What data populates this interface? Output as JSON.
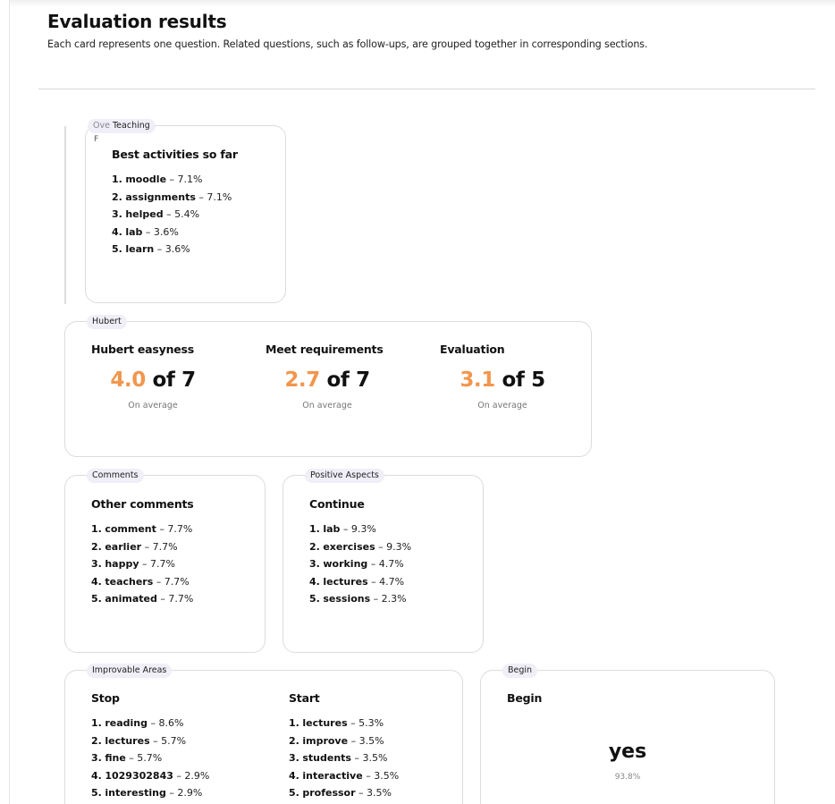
{
  "header": {
    "title": "Evaluation results",
    "subtitle": "Each card represents one question. Related questions, such as follow-ups, are grouped together in corresponding sections."
  },
  "teaching": {
    "tag": "Teaching",
    "partial_tag": "Ove",
    "partial_tag2": "F",
    "card": {
      "title": "Best activities so far",
      "items": [
        {
          "rank": "1.",
          "word": "moodle",
          "pct": "7.1%"
        },
        {
          "rank": "2.",
          "word": "assignments",
          "pct": "7.1%"
        },
        {
          "rank": "3.",
          "word": "helped",
          "pct": "5.4%"
        },
        {
          "rank": "4.",
          "word": "lab",
          "pct": "3.6%"
        },
        {
          "rank": "5.",
          "word": "learn",
          "pct": "3.6%"
        }
      ]
    }
  },
  "hubert": {
    "tag": "Hubert",
    "metrics": [
      {
        "title": "Hubert easyness",
        "value": "4.0",
        "of": " of 7",
        "caption": "On average"
      },
      {
        "title": "Meet requirements",
        "value": "2.7",
        "of": " of 7",
        "caption": "On average"
      },
      {
        "title": "Evaluation",
        "value": "3.1",
        "of": " of 5",
        "caption": "On average"
      }
    ]
  },
  "comments": {
    "tag": "Comments",
    "card": {
      "title": "Other comments",
      "items": [
        {
          "rank": "1.",
          "word": "comment",
          "pct": "7.7%"
        },
        {
          "rank": "2.",
          "word": "earlier",
          "pct": "7.7%"
        },
        {
          "rank": "3.",
          "word": "happy",
          "pct": "7.7%"
        },
        {
          "rank": "4.",
          "word": "teachers",
          "pct": "7.7%"
        },
        {
          "rank": "5.",
          "word": "animated",
          "pct": "7.7%"
        }
      ]
    }
  },
  "positive": {
    "tag": "Positive Aspects",
    "card": {
      "title": "Continue",
      "items": [
        {
          "rank": "1.",
          "word": "lab",
          "pct": "9.3%"
        },
        {
          "rank": "2.",
          "word": "exercises",
          "pct": "9.3%"
        },
        {
          "rank": "3.",
          "word": "working",
          "pct": "4.7%"
        },
        {
          "rank": "4.",
          "word": "lectures",
          "pct": "4.7%"
        },
        {
          "rank": "5.",
          "word": "sessions",
          "pct": "2.3%"
        }
      ]
    }
  },
  "improvable": {
    "tag": "Improvable Areas",
    "stop": {
      "title": "Stop",
      "items": [
        {
          "rank": "1.",
          "word": "reading",
          "pct": "8.6%"
        },
        {
          "rank": "2.",
          "word": "lectures",
          "pct": "5.7%"
        },
        {
          "rank": "3.",
          "word": "fine",
          "pct": "5.7%"
        },
        {
          "rank": "4.",
          "word": "1029302843",
          "pct": "2.9%"
        },
        {
          "rank": "5.",
          "word": "interesting",
          "pct": "2.9%"
        }
      ]
    },
    "start": {
      "title": "Start",
      "items": [
        {
          "rank": "1.",
          "word": "lectures",
          "pct": "5.3%"
        },
        {
          "rank": "2.",
          "word": "improve",
          "pct": "3.5%"
        },
        {
          "rank": "3.",
          "word": "students",
          "pct": "3.5%"
        },
        {
          "rank": "4.",
          "word": "interactive",
          "pct": "3.5%"
        },
        {
          "rank": "5.",
          "word": "professor",
          "pct": "3.5%"
        }
      ]
    }
  },
  "begin": {
    "tag": "Begin",
    "title": "Begin",
    "answer": "yes",
    "pct": "93.8%"
  },
  "colors": {
    "accent": "#f2964d"
  }
}
